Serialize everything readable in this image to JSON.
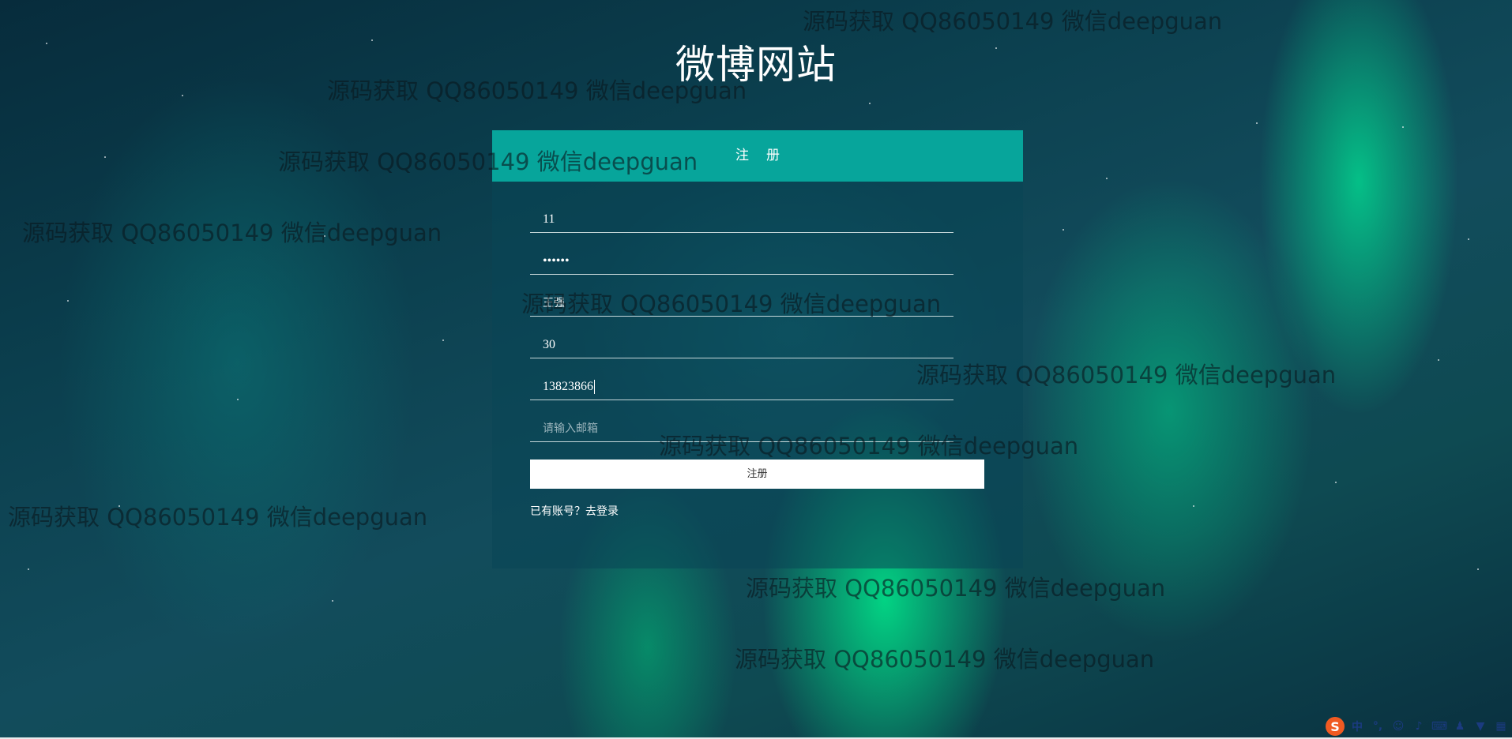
{
  "page": {
    "title": "微博网站"
  },
  "form": {
    "header": "注册",
    "fields": [
      {
        "name": "username",
        "value": "11"
      },
      {
        "name": "password",
        "value": "••••••"
      },
      {
        "name": "realname",
        "value": "王强"
      },
      {
        "name": "age",
        "value": "30"
      },
      {
        "name": "phone",
        "value": "13823866"
      },
      {
        "name": "email",
        "value": "",
        "placeholder": "请输入邮箱"
      }
    ],
    "submit_label": "注册",
    "login_link": "已有账号？去登录"
  },
  "watermark": {
    "text": "源码获取 QQ86050149 微信deepguan"
  },
  "taskbar": {
    "ime_label": "中",
    "logo": "S"
  }
}
